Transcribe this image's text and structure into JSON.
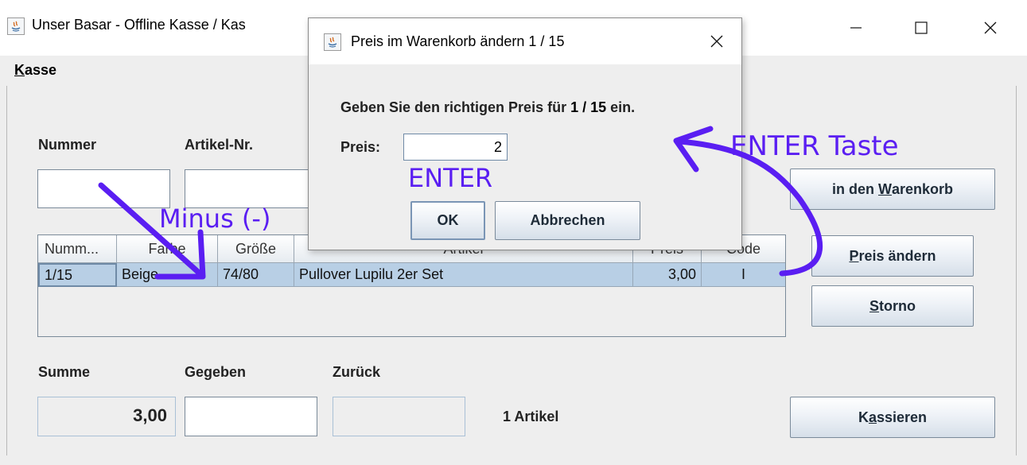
{
  "window": {
    "title": "Unser Basar - Offline Kasse / Kas",
    "minimize": "—",
    "maximize": "☐",
    "close": "✕"
  },
  "menu": {
    "kasse_first": "K",
    "kasse_rest": "asse"
  },
  "labels": {
    "nummer": "Nummer",
    "artikel_nr": "Artikel-Nr.",
    "summe": "Summe",
    "gegeben": "Gegeben",
    "zurueck": "Zurück",
    "artikel_count": "1 Artikel"
  },
  "fields": {
    "nummer": "",
    "artikel_nr": "",
    "summe": "3,00",
    "gegeben": "",
    "zurueck": ""
  },
  "buttons": {
    "warenkorb_pre": "in den ",
    "warenkorb_u": "W",
    "warenkorb_post": "arenkorb",
    "preis_u": "P",
    "preis_post": "reis ändern",
    "storno_u": "S",
    "storno_post": "torno",
    "kassieren_pre": "K",
    "kassieren_u": "a",
    "kassieren_post": "ssieren"
  },
  "table": {
    "columns": [
      "Numm...",
      "Farbe",
      "Größe",
      "Artikel",
      "Preis",
      "Code"
    ],
    "rows": [
      {
        "nummer": "1/15",
        "farbe": "Beige",
        "groesse": "74/80",
        "artikel": "Pullover Lupilu 2er Set",
        "preis": "3,00",
        "code": "I"
      }
    ]
  },
  "dialog": {
    "title": "Preis im Warenkorb ändern 1 / 15",
    "prompt_pre": "Geben Sie den richtigen Preis für ",
    "prompt_bold": "1 / 15",
    "prompt_post": " ein.",
    "preis_label": "Preis:",
    "preis_value": "2",
    "ok": "OK",
    "cancel": "Abbrechen",
    "close": "✕"
  },
  "annotations": {
    "minus": "Minus (-)",
    "enter": "ENTER",
    "enter_taste": "ENTER Taste",
    "color": "#5a1ef2"
  }
}
